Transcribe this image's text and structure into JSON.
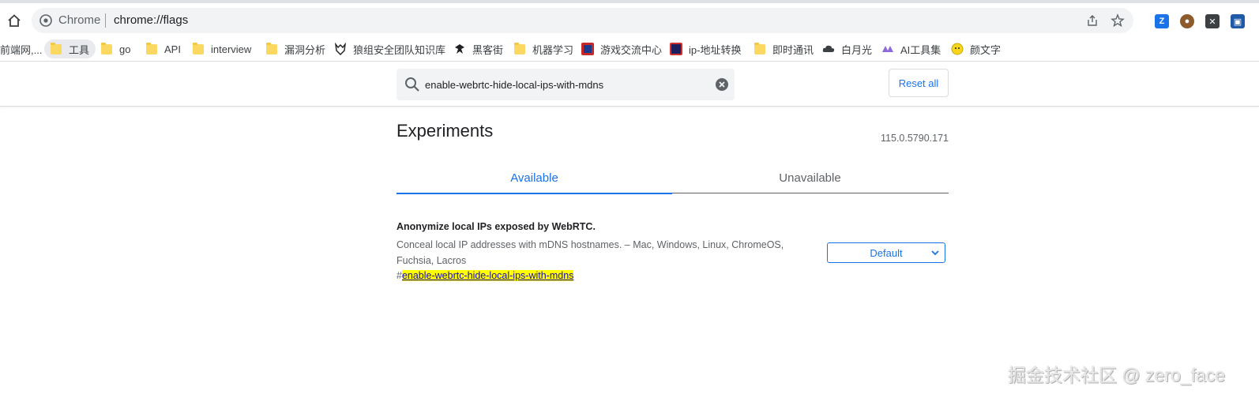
{
  "browser": {
    "site_name": "Chrome",
    "url": "chrome://flags"
  },
  "bookmarks": [
    {
      "label": "前端网,...",
      "icon": "text"
    },
    {
      "label": "工具",
      "icon": "folder-icon",
      "active": true
    },
    {
      "label": "go",
      "icon": "folder-icon"
    },
    {
      "label": "API",
      "icon": "folder-icon"
    },
    {
      "label": "interview",
      "icon": "folder-icon"
    },
    {
      "label": "漏洞分析",
      "icon": "folder-icon"
    },
    {
      "label": "狼组安全团队知识库",
      "icon": "wolf-icon"
    },
    {
      "label": "黑客街",
      "icon": "hacker-icon"
    },
    {
      "label": "机器学习",
      "icon": "folder-icon"
    },
    {
      "label": "游戏交流中心",
      "icon": "game-icon"
    },
    {
      "label": "ip-地址转换",
      "icon": "ip-icon"
    },
    {
      "label": "即时通讯",
      "icon": "folder-icon"
    },
    {
      "label": "白月光",
      "icon": "cloud-icon"
    },
    {
      "label": "AI工具集",
      "icon": "ai-icon"
    },
    {
      "label": "颜文字",
      "icon": "smiley-icon"
    }
  ],
  "search": {
    "value": "enable-webrtc-hide-local-ips-with-mdns",
    "placeholder": "Search flags"
  },
  "reset_label": "Reset all",
  "page": {
    "title": "Experiments",
    "version": "115.0.5790.171"
  },
  "tabs": [
    {
      "label": "Available",
      "selected": true
    },
    {
      "label": "Unavailable",
      "selected": false
    }
  ],
  "experiment": {
    "name": "Anonymize local IPs exposed by WebRTC.",
    "description": "Conceal local IP addresses with mDNS hostnames. – Mac, Windows, Linux, ChromeOS, Fuchsia, Lacros",
    "hash": "#",
    "anchor": "enable-webrtc-hide-local-ips-with-mdns",
    "selected_option": "Default"
  },
  "watermark": "掘金技术社区 @ zero_face",
  "colors": {
    "accent": "#1a73e8",
    "highlight": "#ffff00"
  }
}
